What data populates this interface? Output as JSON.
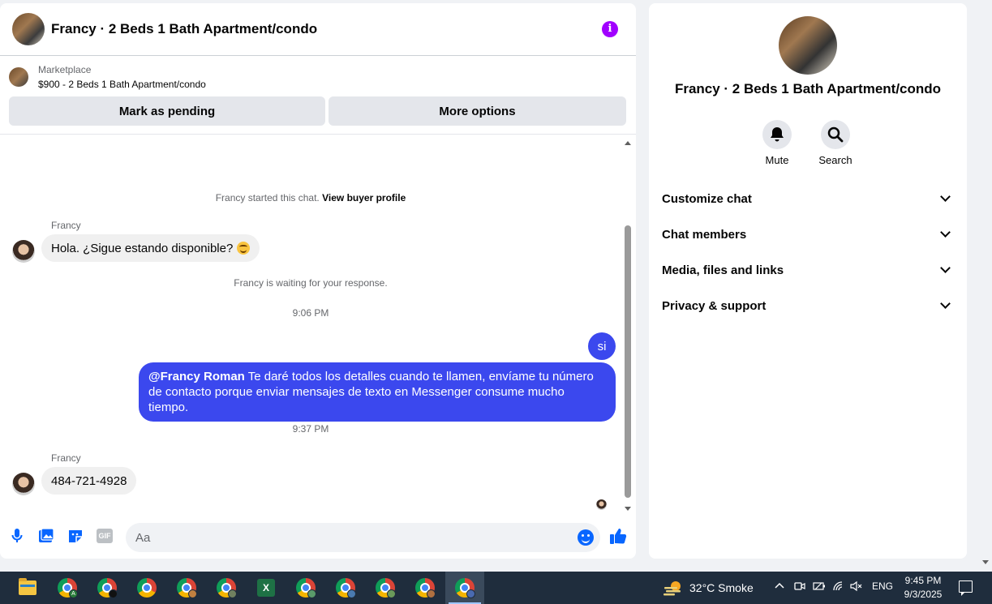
{
  "chat": {
    "title": "Francy · 2 Beds 1 Bath Apartment/condo",
    "info_icon": "info-icon",
    "marketplace": {
      "label": "Marketplace",
      "listing": "$900 - 2 Beds 1 Bath Apartment/condo",
      "mark_pending_label": "Mark as pending",
      "more_options_label": "More options"
    },
    "system_started_prefix": "Francy started this chat.",
    "view_profile_link": "View buyer profile",
    "messages": [
      {
        "sender": "Francy",
        "text": "Hola. ¿Sigue estando disponible?"
      },
      {
        "system": "Francy is waiting for your response."
      },
      {
        "time": "9:06 PM"
      },
      {
        "outgoing": "si"
      },
      {
        "mention": "@Francy Roman",
        "outgoing": " Te daré todos los detalles cuando te llamen, envíame tu número de contacto porque enviar mensajes de texto en Messenger consume mucho tiempo."
      },
      {
        "time": "9:37 PM"
      },
      {
        "sender": "Francy",
        "text": "484-721-4928"
      }
    ],
    "composer": {
      "placeholder": "Aa",
      "icons": [
        "microphone-icon",
        "photo-icon",
        "sticker-icon",
        "gif-icon",
        "emoji-icon",
        "thumbs-up-icon"
      ],
      "gif_label": "GIF"
    }
  },
  "details": {
    "title": "Francy · 2 Beds 1 Bath Apartment/condo",
    "actions": [
      {
        "label": "Mute",
        "icon": "bell-icon"
      },
      {
        "label": "Search",
        "icon": "search-icon"
      }
    ],
    "sections": [
      "Customize chat",
      "Chat members",
      "Media, files and links",
      "Privacy & support"
    ]
  },
  "taskbar": {
    "weather": "32°C  Smoke",
    "language": "ENG",
    "time": "9:45 PM",
    "date": "9/3/2025",
    "excel_letter": "X",
    "badges": [
      "A",
      "●"
    ]
  },
  "colors": {
    "accent": "#0866ff",
    "outgoing_bubble": "#3b48ee",
    "info": "#a100ff",
    "taskbar": "#1f2d3d"
  }
}
